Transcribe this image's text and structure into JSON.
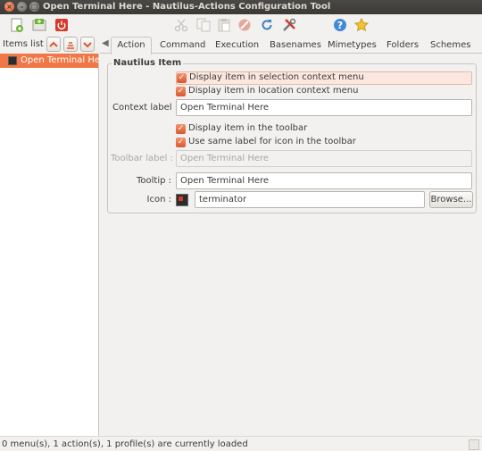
{
  "window": {
    "title": "Open Terminal Here - Nautilus-Actions Configuration Tool",
    "close_glyph": "×",
    "min_glyph": "–",
    "max_glyph": "□"
  },
  "toolbar": {
    "icons": [
      "new-menu-icon",
      "new-action-icon",
      "quit-icon",
      "cut-icon",
      "copy-icon",
      "paste-icon",
      "delete-icon",
      "undo-icon",
      "preferences-icon",
      "help-icon",
      "about-icon"
    ]
  },
  "items_list": {
    "label": "Items list :",
    "items": [
      {
        "label": "Open Terminal Here",
        "selected": true
      }
    ]
  },
  "tabs": [
    "Action",
    "Command",
    "Execution",
    "Basenames",
    "Mimetypes",
    "Folders",
    "Schemes"
  ],
  "active_tab": "Action",
  "nautilus_item": {
    "title": "Nautilus Item",
    "display_selection": {
      "label": "Display item in selection context menu",
      "checked": true
    },
    "display_location": {
      "label": "Display item in location context menu",
      "checked": true
    },
    "context_label": {
      "label": "Context label :",
      "value": "Open Terminal Here"
    },
    "display_toolbar": {
      "label": "Display item in the toolbar",
      "checked": true
    },
    "same_label": {
      "label": "Use same label for icon in the toolbar",
      "checked": true
    },
    "toolbar_label": {
      "label": "Toolbar label :",
      "value": "Open Terminal Here",
      "disabled": true
    },
    "tooltip": {
      "label": "Tooltip :",
      "value": "Open Terminal Here"
    },
    "icon": {
      "label": "Icon :",
      "value": "terminator",
      "browse": "Browse..."
    }
  },
  "checkmark": "✓",
  "status": "0 menu(s), 1 action(s), 1 profile(s) are currently loaded",
  "colors": {
    "accent": "#f07746",
    "titlebar": "#3b3a36",
    "background": "#f2f1f0"
  }
}
